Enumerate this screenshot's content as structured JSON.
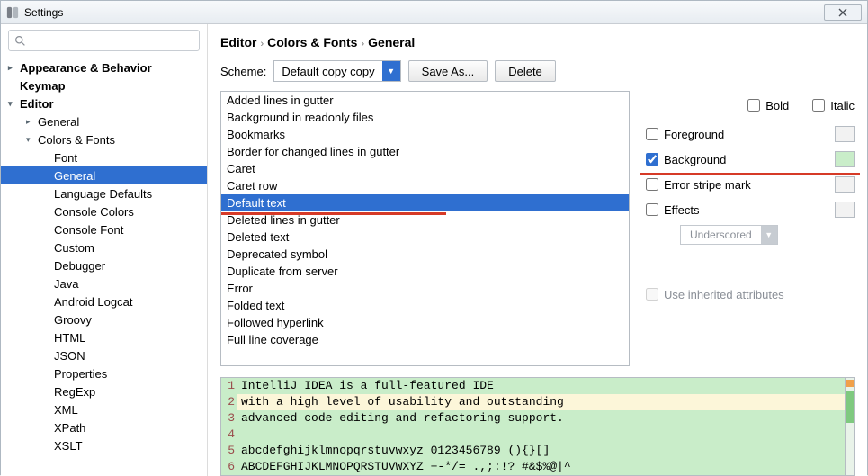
{
  "window": {
    "title": "Settings"
  },
  "search": {
    "placeholder": ""
  },
  "tree": [
    {
      "label": "Appearance & Behavior",
      "level": 0,
      "bold": true,
      "arrow": "▸"
    },
    {
      "label": "Keymap",
      "level": 0,
      "bold": true,
      "arrow": ""
    },
    {
      "label": "Editor",
      "level": 0,
      "bold": true,
      "arrow": "▾"
    },
    {
      "label": "General",
      "level": 1,
      "arrow": "▸"
    },
    {
      "label": "Colors & Fonts",
      "level": 1,
      "arrow": "▾"
    },
    {
      "label": "Font",
      "level": 2
    },
    {
      "label": "General",
      "level": 2,
      "selected": true
    },
    {
      "label": "Language Defaults",
      "level": 2
    },
    {
      "label": "Console Colors",
      "level": 2
    },
    {
      "label": "Console Font",
      "level": 2
    },
    {
      "label": "Custom",
      "level": 2
    },
    {
      "label": "Debugger",
      "level": 2
    },
    {
      "label": "Java",
      "level": 2
    },
    {
      "label": "Android Logcat",
      "level": 2
    },
    {
      "label": "Groovy",
      "level": 2
    },
    {
      "label": "HTML",
      "level": 2
    },
    {
      "label": "JSON",
      "level": 2
    },
    {
      "label": "Properties",
      "level": 2
    },
    {
      "label": "RegExp",
      "level": 2
    },
    {
      "label": "XML",
      "level": 2
    },
    {
      "label": "XPath",
      "level": 2
    },
    {
      "label": "XSLT",
      "level": 2
    }
  ],
  "breadcrumb": {
    "a": "Editor",
    "b": "Colors & Fonts",
    "c": "General"
  },
  "scheme": {
    "label": "Scheme:",
    "value": "Default copy copy",
    "save_as": "Save As...",
    "delete": "Delete"
  },
  "list": [
    "Added lines in gutter",
    "Background in readonly files",
    "Bookmarks",
    "Border for changed lines in gutter",
    "Caret",
    "Caret row",
    "Default text",
    "Deleted lines in gutter",
    "Deleted text",
    "Deprecated symbol",
    "Duplicate from server",
    "Error",
    "Folded text",
    "Followed hyperlink",
    "Full line coverage"
  ],
  "list_selected_index": 6,
  "props": {
    "bold": "Bold",
    "italic": "Italic",
    "foreground": "Foreground",
    "background": "Background",
    "error_stripe": "Error stripe mark",
    "effects": "Effects",
    "effects_value": "Underscored",
    "inherited": "Use inherited attributes",
    "background_checked": true
  },
  "preview": {
    "lines": [
      "IntelliJ IDEA is a full-featured IDE",
      "with a high level of usability and outstanding",
      "advanced code editing and refactoring support.",
      "",
      "abcdefghijklmnopqrstuvwxyz 0123456789 (){}[]",
      "ABCDEFGHIJKLMNOPQRSTUVWXYZ +-*/= .,;:!? #&$%@|^"
    ],
    "highlighted_line_index": 1
  }
}
